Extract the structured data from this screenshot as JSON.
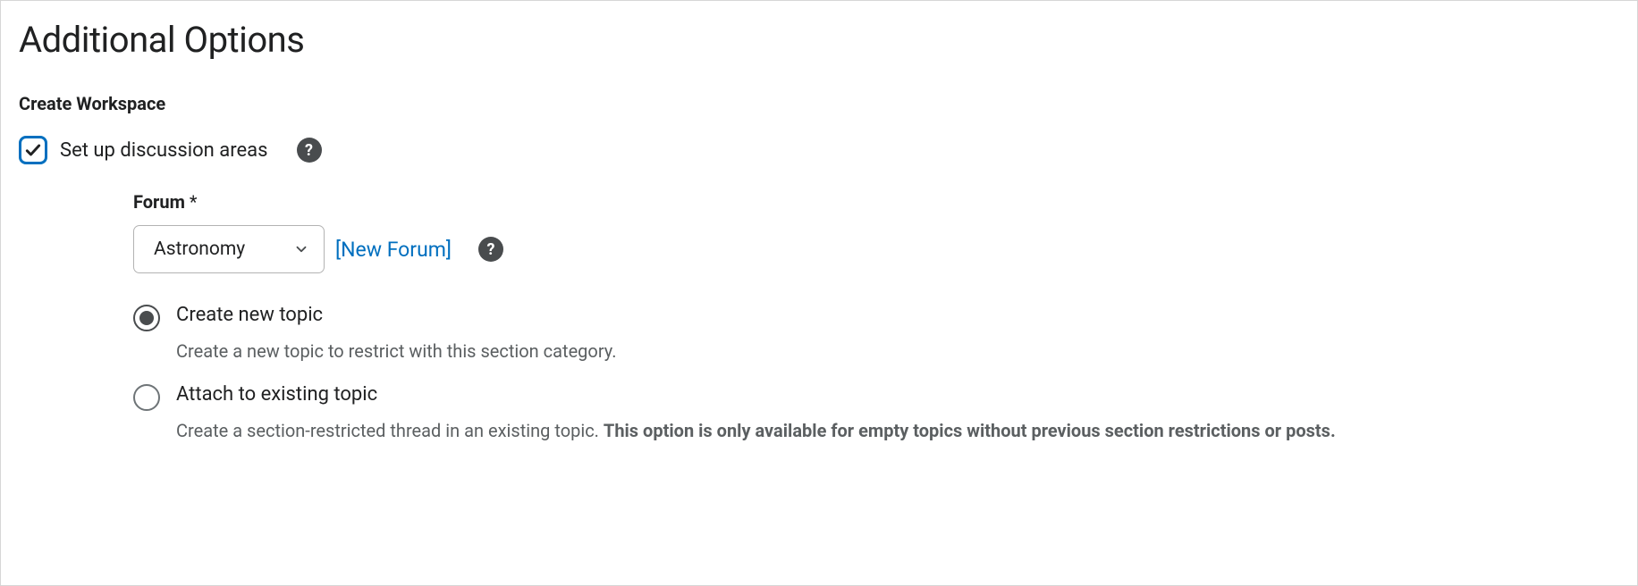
{
  "page_title": "Additional Options",
  "section_title": "Create Workspace",
  "checkbox": {
    "label": "Set up discussion areas",
    "checked": true
  },
  "forum": {
    "label": "Forum",
    "required_marker": "*",
    "selected": "Astronomy",
    "new_forum_link": "[New Forum]"
  },
  "radios": {
    "create_new": {
      "label": "Create new topic",
      "description": "Create a new topic to restrict with this section category.",
      "bold": ""
    },
    "attach_existing": {
      "label": "Attach to existing topic",
      "description": "Create a section-restricted thread in an existing topic. ",
      "bold": "This option is only available for empty topics without previous section restrictions or posts."
    }
  },
  "icons": {
    "help": "?"
  }
}
